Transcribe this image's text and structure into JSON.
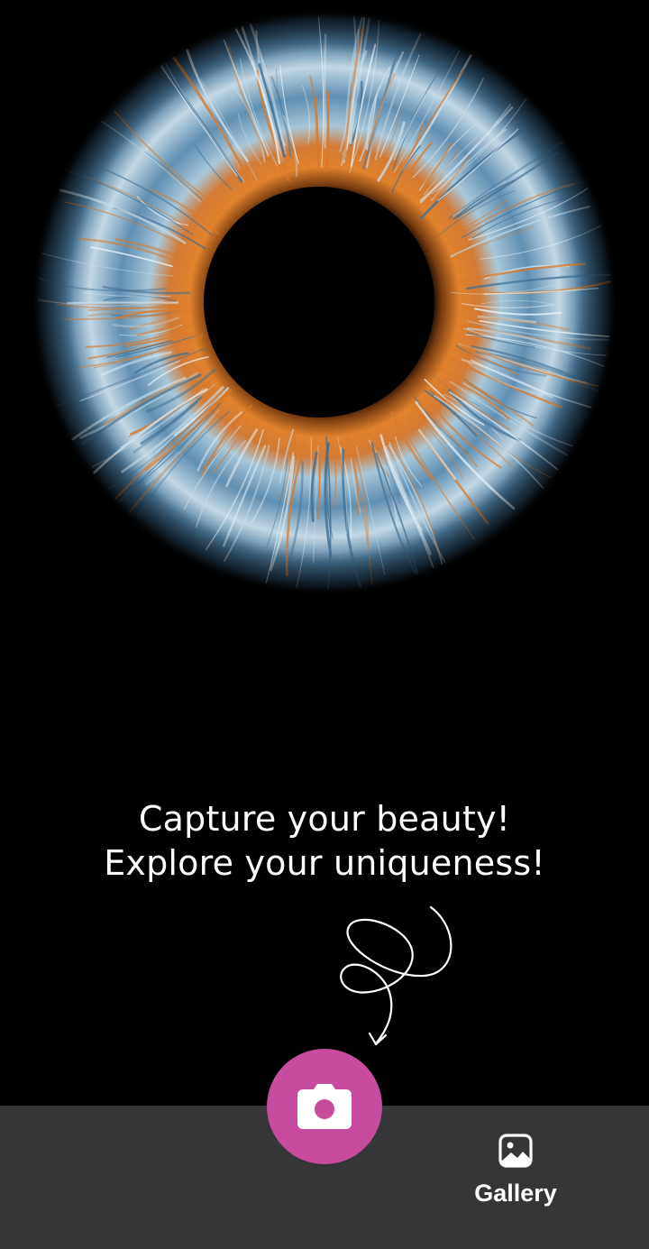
{
  "tagline": {
    "line1": "Capture your beauty!",
    "line2": "Explore your uniqueness!"
  },
  "hero": {
    "image": "blue-orange-iris-closeup",
    "colors": {
      "iris_outer": "#3e6f93",
      "iris_light": "#c9dbe6",
      "iris_ring": "#d8792a",
      "pupil": "#000000"
    }
  },
  "decoration": {
    "icon": "curly-arrow-doodle"
  },
  "bottom_bar": {
    "background": "#363639",
    "capture_button": {
      "icon": "camera-icon",
      "color": "#c84c9e"
    },
    "gallery": {
      "icon": "image-icon",
      "label": "Gallery"
    }
  }
}
